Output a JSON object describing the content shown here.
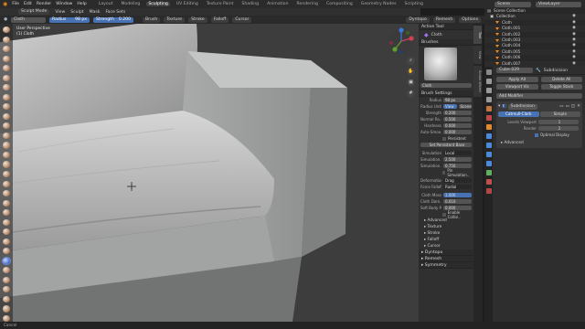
{
  "top_menu": {
    "items": [
      "File",
      "Edit",
      "Render",
      "Window",
      "Help"
    ],
    "workspaces": [
      "Layout",
      "Modeling",
      "Sculpting",
      "UV Editing",
      "Texture Paint",
      "Shading",
      "Animation",
      "Rendering",
      "Compositing",
      "Geometry Nodes",
      "Scripting"
    ],
    "active_workspace": "Sculpting",
    "scene_label": "Scene",
    "view_layer_label": "ViewLayer"
  },
  "header": {
    "mode": "Sculpt Mode",
    "menus": [
      "View",
      "Sculpt",
      "Mask",
      "Face Sets"
    ],
    "right": [
      "Dyntopo",
      "Remesh",
      "Options"
    ]
  },
  "tool_header": {
    "brush_name": "Cloth",
    "radius_label": "Radius",
    "radius_value": "98 px",
    "strength_label": "Strength",
    "strength_value": "0.200",
    "dropdowns": [
      "Brush",
      "Texture",
      "Stroke",
      "Falloff",
      "Cursor"
    ]
  },
  "viewport": {
    "overlay_text": [
      "User Perspective",
      "(1) Cloth"
    ]
  },
  "tool_panel": {
    "active_tool_title": "Active Tool",
    "active_tool_name": "Cloth",
    "brushes_title": "Brushes",
    "brush_field": "Cloth",
    "brush_settings_title": "Brush Settings",
    "radius": {
      "label": "Radius",
      "value": "98 px"
    },
    "radius_unit": {
      "label": "Radius Unit",
      "options": [
        "View",
        "Scene"
      ],
      "active": "View"
    },
    "strength": {
      "label": "Strength",
      "value": "0.200"
    },
    "normal_radius": {
      "label": "Normal Ra..",
      "value": "0.500"
    },
    "hardness": {
      "label": "Hardness",
      "value": "0.000"
    },
    "auto_smooth": {
      "label": "Auto-Smoo..",
      "value": "0.000"
    },
    "persistent_label": "Persistent",
    "set_persistent_label": "Set Persistent Base",
    "simulation": {
      "label": "Simulation",
      "value": "Local"
    },
    "sim_limit": {
      "label": "Simulation..",
      "value": "2.500"
    },
    "sim_falloff": {
      "label": "Simulation..",
      "value": "0.750"
    },
    "pin_label": "Pin Simulation..",
    "deformation": {
      "label": "Deformation",
      "value": "Drag"
    },
    "force_falloff": {
      "label": "Force Falloff",
      "value": "Radial"
    },
    "cloth_mass": {
      "label": "Cloth Mass",
      "value": "1.000"
    },
    "cloth_damping": {
      "label": "Cloth Dam..",
      "value": "0.010"
    },
    "soft_body": {
      "label": "Soft Body P..",
      "value": "0.000"
    },
    "enable_collision": "Enable Collisi..",
    "subpanels": [
      "Advanced",
      "Texture",
      "Stroke",
      "Falloff",
      "Cursor"
    ],
    "bottom_panels": [
      "Dyntopo",
      "Remesh",
      "Symmetry"
    ]
  },
  "sidebar_tabs": [
    "Tool",
    "View",
    "Sculpt Wheel"
  ],
  "outliner": {
    "root": "Scene Collection",
    "collection": "Collection",
    "objects": [
      "Cloth",
      "Cloth.001",
      "Cloth.002",
      "Cloth.003",
      "Cloth.004",
      "Cloth.005",
      "Cloth.006",
      "Cloth.007"
    ]
  },
  "properties": {
    "object_name": "Cube.029",
    "modifier_tab": "Subdivision",
    "apply_all": "Apply All",
    "delete_all": "Delete All",
    "viewport_vis": "Viewport Vis",
    "toggle_stack": "Toggle Stack",
    "add_modifier": "Add Modifier",
    "modifier_name": "Subdivision",
    "catmull_clark": "Catmull-Clark",
    "simple": "Simple",
    "levels_viewport": {
      "label": "Levels Viewport",
      "value": "1"
    },
    "render": {
      "label": "Render",
      "value": "2"
    },
    "optimal_display": "Optimal Display",
    "advanced": "Advanced"
  },
  "status_bar": {
    "text": "Cancel"
  },
  "colors": {
    "accent": "#4772b3",
    "orange": "#f08a1a",
    "bg": "#1d1d1d"
  }
}
